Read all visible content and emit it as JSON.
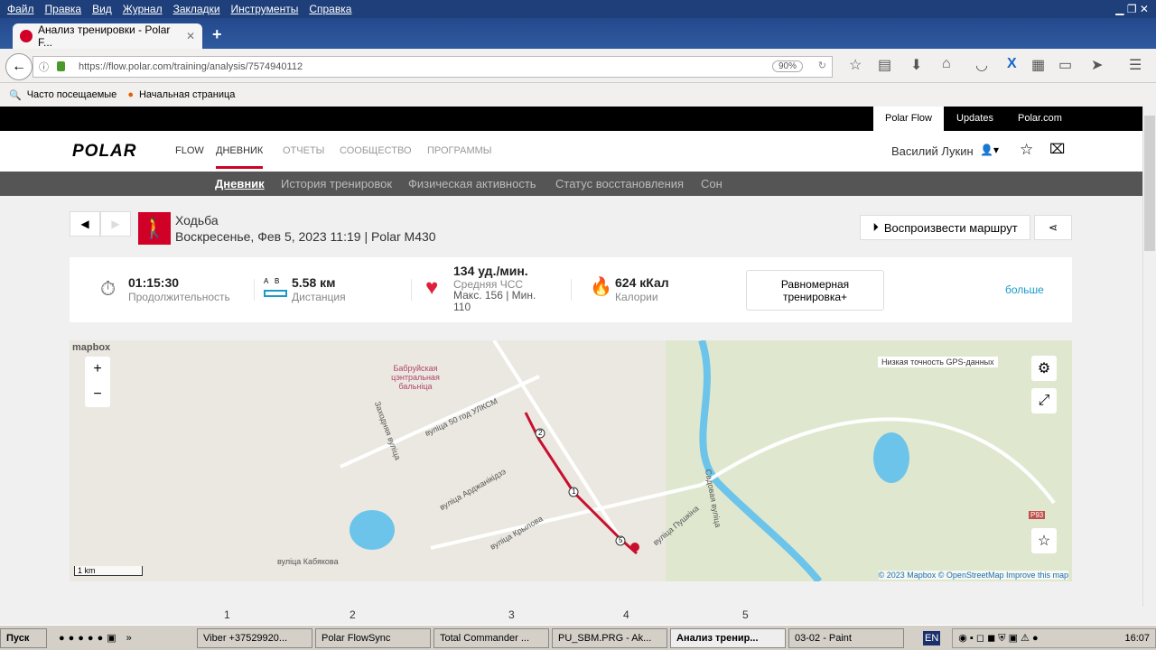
{
  "browser": {
    "menu": [
      "Файл",
      "Правка",
      "Вид",
      "Журнал",
      "Закладки",
      "Инструменты",
      "Справка"
    ],
    "tab_title": "Анализ тренировки - Polar F...",
    "url": "https://flow.polar.com/training/analysis/7574940112",
    "zoom": "90%",
    "bookmarks": [
      "Часто посещаемые",
      "Начальная страница"
    ]
  },
  "site": {
    "top_links": [
      "Polar Flow",
      "Updates",
      "Polar.com"
    ],
    "logo": "POLAR",
    "nav": [
      "FLOW",
      "ДНЕВНИК",
      "ОТЧЕТЫ",
      "СООБЩЕСТВО",
      "ПРОГРАММЫ"
    ],
    "user": "Василий Лукин",
    "subnav": [
      "Дневник",
      "История тренировок",
      "Физическая активность",
      "Статус восстановления",
      "Сон"
    ]
  },
  "training": {
    "sport": "Ходьба",
    "date_device": "Воскресенье, Фев 5, 2023 11:19 | Polar M430",
    "replay": "Воспроизвести маршрут",
    "duration": {
      "value": "01:15:30",
      "label": "Продолжительность"
    },
    "distance": {
      "value": "5.58 км",
      "label": "Дистанция",
      "a": "A",
      "b": "B"
    },
    "hr": {
      "value": "134 уд./мин.",
      "label": "Средняя ЧСС",
      "minmax": "Макс. 156 | Мин. 110"
    },
    "calories": {
      "value": "624 кКал",
      "label": "Калории"
    },
    "benefit": "Равномерная тренировка+",
    "more": "больше"
  },
  "map": {
    "brand": "mapbox",
    "gps_note": "Низкая точность GPS-данных",
    "labels": [
      "Бабруйская цэнтральная бальніца",
      "вуліца 50 год УЛКСМ",
      "Заходняя вуліца",
      "вуліца Арджанікідзэ",
      "вуліца Крылова",
      "вуліца Кабякова",
      "вуліца Пушкіна",
      "Садовая вуліца",
      "P93"
    ],
    "scale": "1 km",
    "attribution": "© 2023 Mapbox © OpenStreetMap Improve this map",
    "markers": [
      "1",
      "2",
      "5"
    ],
    "route_color": "#c8102e"
  },
  "taskbar": {
    "start": "Пуск",
    "tasks": [
      "Viber +37529920...",
      "Polar FlowSync",
      "Total Commander ...",
      "PU_SBM.PRG - Ak...",
      "Анализ тренир...",
      "03-02 - Paint"
    ],
    "numbers": [
      "1",
      "2",
      "3",
      "4",
      "5"
    ],
    "lang": "EN",
    "clock": "16:07"
  },
  "colors": {
    "accent": "#d10027",
    "link": "#1a9ac9"
  }
}
